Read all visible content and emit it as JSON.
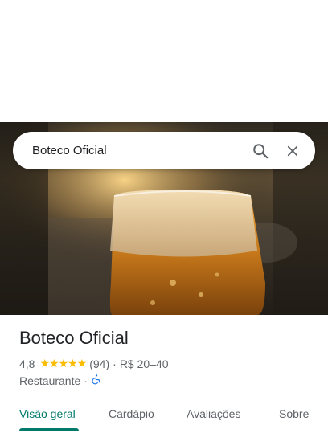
{
  "search": {
    "query": "Boteco Oficial"
  },
  "place": {
    "name": "Boteco Oficial",
    "rating": "4,8",
    "stars": "★★★★★",
    "reviews": "(94)",
    "separator": "·",
    "price": "R$ 20–40",
    "category": "Restaurante",
    "category_separator": "·"
  },
  "tabs": [
    {
      "label": "Visão geral",
      "active": true
    },
    {
      "label": "Cardápio"
    },
    {
      "label": "Avaliações"
    },
    {
      "label": "Sobre"
    }
  ],
  "colors": {
    "accent": "#00796b",
    "star": "#fbbc04",
    "accessibility": "#1a73e8"
  },
  "icons": {
    "search": "search-icon",
    "close": "close-icon",
    "accessibility": "wheelchair-icon"
  }
}
